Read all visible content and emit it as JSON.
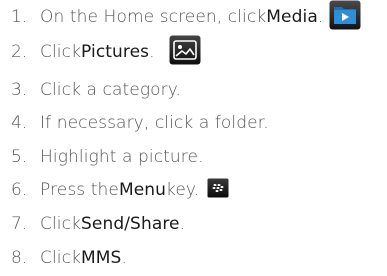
{
  "steps": [
    {
      "num": "1.",
      "pre": "On the Home screen, click ",
      "hl": "Media",
      "post": ".",
      "icon": "media-app-icon"
    },
    {
      "num": "2.",
      "pre": "Click ",
      "hl": "Pictures",
      "post": ".",
      "icon": "pictures-app-icon"
    },
    {
      "num": "3.",
      "pre": "Click a category.",
      "hl": "",
      "post": "",
      "icon": ""
    },
    {
      "num": "4.",
      "pre": "If necessary, click a folder.",
      "hl": "",
      "post": "",
      "icon": ""
    },
    {
      "num": "5.",
      "pre": "Highlight a picture.",
      "hl": "",
      "post": "",
      "icon": ""
    },
    {
      "num": "6.",
      "pre": "Press the ",
      "hl": "Menu",
      "post": " key.",
      "icon": "blackberry-menu-key-icon"
    },
    {
      "num": "7.",
      "pre": "Click ",
      "hl": "Send/Share",
      "post": ".",
      "icon": ""
    },
    {
      "num": "8.",
      "pre": "Click ",
      "hl": "MMS",
      "post": ".",
      "icon": ""
    }
  ]
}
